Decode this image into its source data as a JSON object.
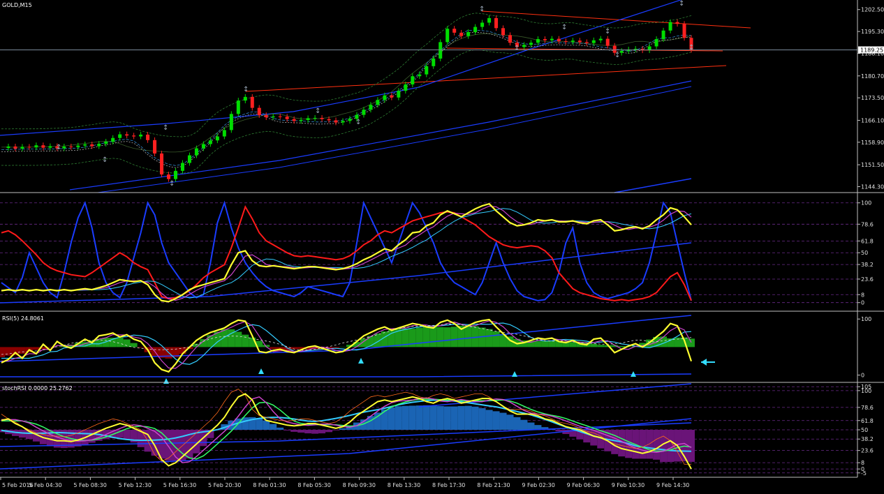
{
  "window": {
    "symbol_label": "GOLD,M15",
    "current_price": "1189.25",
    "bg": "#000000",
    "axis_color": "#c0c0c0",
    "grid_color": "#6a2a8a"
  },
  "panels": {
    "price": {
      "ticks": [
        "1202.50",
        "1195.30",
        "1188.10",
        "1180.70",
        "1173.50",
        "1166.10",
        "1158.90",
        "1151.50",
        "1144.30"
      ],
      "tick_values": [
        1202.5,
        1195.3,
        1188.1,
        1180.7,
        1173.5,
        1166.1,
        1158.9,
        1151.5,
        1144.3
      ],
      "ylim": [
        1143.5,
        1204.5
      ]
    },
    "osc1": {
      "ticks": [
        "100",
        "78.6",
        "61.8",
        "50",
        "38.2",
        "23.6",
        "8",
        "0"
      ],
      "tick_values": [
        100,
        78.6,
        61.8,
        50,
        38.2,
        23.6,
        8,
        0
      ],
      "ylim": [
        -3,
        104
      ]
    },
    "rsi": {
      "label": "RSI(5) 24.8061",
      "ticks": [
        "100",
        "0"
      ],
      "tick_values": [
        100,
        0
      ],
      "ylim": [
        -3,
        104
      ]
    },
    "stoch": {
      "label": "stochRSI 0.0000 25.2762",
      "ticks": [
        "105",
        "100",
        "78.6",
        "61.8",
        "50",
        "38.2",
        "23.6",
        "8",
        "0",
        "-5"
      ],
      "tick_values": [
        105,
        100,
        78.6,
        61.8,
        50,
        38.2,
        23.6,
        8,
        0,
        -5
      ],
      "ylim": [
        -7,
        107
      ]
    }
  },
  "time_axis": {
    "labels": [
      "5 Feb 2016",
      "5 Feb 04:30",
      "5 Feb 08:30",
      "5 Feb 12:30",
      "5 Feb 16:30",
      "5 Feb 20:30",
      "8 Feb 01:30",
      "8 Feb 05:30",
      "8 Feb 09:30",
      "8 Feb 13:30",
      "8 Feb 17:30",
      "8 Feb 21:30",
      "9 Feb 02:30",
      "9 Feb 06:30",
      "9 Feb 10:30",
      "9 Feb 14:30"
    ]
  },
  "chart_data": {
    "type": "line",
    "title": "GOLD,M15",
    "price_series": [
      1157,
      1157.5,
      1156.8,
      1157.4,
      1157.2,
      1157.9,
      1157.1,
      1157.6,
      1156.9,
      1157.5,
      1157.3,
      1157.8,
      1158.2,
      1157.6,
      1158.4,
      1159.1,
      1160.3,
      1161.5,
      1161.1,
      1160.8,
      1161.4,
      1159.6,
      1155.2,
      1148.3,
      1146.8,
      1149.5,
      1152.1,
      1154.6,
      1156.9,
      1158.3,
      1159.5,
      1160.8,
      1162.9,
      1168.2,
      1172.6,
      1173.8,
      1170.2,
      1167.8,
      1167.1,
      1167.4,
      1167.3,
      1166.5,
      1165.9,
      1166.2,
      1166.8,
      1166.9,
      1166.5,
      1166.1,
      1165.4,
      1165.9,
      1166.6,
      1167.9,
      1169.6,
      1171.2,
      1172.8,
      1174.3,
      1173.6,
      1175.8,
      1177.9,
      1180.6,
      1181.2,
      1183.9,
      1186.4,
      1191.8,
      1196.2,
      1194.9,
      1193.8,
      1195.1,
      1196.8,
      1198.2,
      1199.7,
      1196.4,
      1194.1,
      1191.6,
      1190.2,
      1190.9,
      1191.6,
      1192.8,
      1192.4,
      1192.9,
      1192.1,
      1191.9,
      1192.3,
      1191.8,
      1191.5,
      1192.4,
      1192.9,
      1190.6,
      1188.3,
      1188.9,
      1189.4,
      1189.6,
      1189.1,
      1190.4,
      1192.8,
      1195.6,
      1198.4,
      1197.8,
      1193.2,
      1189.25
    ],
    "osc1_series": {
      "yellow": [
        12,
        13,
        12,
        13,
        12,
        13,
        12,
        13,
        12,
        13,
        12,
        13,
        14,
        13,
        15,
        17,
        20,
        23,
        22,
        21,
        22,
        18,
        8,
        2,
        1,
        4,
        8,
        13,
        16,
        18,
        20,
        22,
        24,
        38,
        50,
        52,
        42,
        37,
        36,
        37,
        36,
        35,
        34,
        35,
        36,
        36,
        35,
        34,
        33,
        34,
        36,
        39,
        43,
        46,
        50,
        54,
        52,
        58,
        63,
        70,
        71,
        77,
        80,
        88,
        92,
        89,
        86,
        90,
        94,
        97,
        99,
        92,
        86,
        80,
        77,
        78,
        80,
        83,
        82,
        83,
        81,
        81,
        82,
        80,
        79,
        82,
        83,
        78,
        72,
        73,
        75,
        76,
        74,
        77,
        83,
        88,
        95,
        93,
        86,
        78
      ],
      "red": [
        70,
        72,
        68,
        62,
        55,
        48,
        40,
        35,
        32,
        30,
        28,
        27,
        26,
        30,
        35,
        40,
        45,
        50,
        46,
        40,
        36,
        33,
        20,
        6,
        4,
        5,
        8,
        12,
        18,
        25,
        30,
        34,
        38,
        55,
        75,
        96,
        84,
        70,
        62,
        58,
        54,
        50,
        47,
        46,
        47,
        46,
        45,
        44,
        43,
        44,
        47,
        52,
        58,
        62,
        68,
        72,
        70,
        74,
        78,
        82,
        84,
        86,
        88,
        90,
        91,
        90,
        86,
        82,
        78,
        72,
        66,
        62,
        58,
        56,
        55,
        56,
        57,
        56,
        52,
        45,
        30,
        22,
        14,
        10,
        8,
        6,
        4,
        3,
        2,
        3,
        2,
        3,
        4,
        6,
        10,
        18,
        26,
        30,
        18,
        2
      ],
      "blue": [
        20,
        15,
        10,
        25,
        50,
        35,
        20,
        10,
        5,
        30,
        60,
        85,
        100,
        75,
        40,
        20,
        10,
        5,
        20,
        45,
        70,
        100,
        88,
        60,
        40,
        30,
        20,
        10,
        5,
        8,
        40,
        80,
        100,
        75,
        55,
        40,
        30,
        22,
        16,
        12,
        10,
        8,
        6,
        10,
        16,
        14,
        12,
        10,
        8,
        6,
        20,
        60,
        100,
        85,
        70,
        55,
        40,
        60,
        80,
        100,
        90,
        75,
        60,
        40,
        28,
        20,
        16,
        12,
        8,
        20,
        40,
        60,
        40,
        24,
        12,
        6,
        4,
        2,
        3,
        10,
        30,
        60,
        75,
        40,
        20,
        10,
        6,
        4,
        6,
        8,
        10,
        14,
        20,
        40,
        70,
        100,
        90,
        60,
        30,
        2
      ]
    },
    "rsi_series": [
      22,
      28,
      40,
      30,
      45,
      38,
      55,
      44,
      60,
      52,
      48,
      56,
      64,
      58,
      70,
      72,
      75,
      68,
      72,
      64,
      60,
      45,
      22,
      10,
      6,
      20,
      38,
      50,
      62,
      70,
      76,
      80,
      84,
      92,
      98,
      96,
      70,
      42,
      40,
      44,
      46,
      42,
      40,
      45,
      50,
      52,
      48,
      44,
      40,
      42,
      50,
      60,
      70,
      76,
      82,
      86,
      80,
      84,
      88,
      92,
      90,
      86,
      84,
      94,
      98,
      92,
      82,
      88,
      94,
      97,
      99,
      86,
      74,
      62,
      56,
      58,
      62,
      66,
      64,
      66,
      60,
      58,
      62,
      56,
      54,
      64,
      66,
      54,
      40,
      46,
      52,
      56,
      50,
      58,
      68,
      78,
      92,
      88,
      62,
      24.8
    ],
    "stoch_series": [
      62,
      64,
      58,
      54,
      48,
      44,
      40,
      38,
      36,
      36,
      35,
      37,
      40,
      44,
      48,
      52,
      55,
      58,
      56,
      52,
      48,
      44,
      30,
      12,
      4,
      8,
      16,
      24,
      32,
      40,
      48,
      56,
      66,
      80,
      92,
      96,
      88,
      70,
      62,
      60,
      58,
      56,
      55,
      56,
      58,
      58,
      56,
      54,
      52,
      54,
      60,
      68,
      74,
      80,
      86,
      88,
      86,
      88,
      90,
      92,
      90,
      86,
      84,
      88,
      90,
      88,
      84,
      86,
      88,
      90,
      90,
      86,
      80,
      74,
      70,
      70,
      70,
      68,
      64,
      62,
      58,
      54,
      52,
      50,
      46,
      42,
      40,
      36,
      30,
      26,
      24,
      22,
      20,
      22,
      26,
      32,
      36,
      30,
      16,
      0
    ]
  },
  "colors": {
    "bull_candle": "#00dd00",
    "bear_candle": "#ff2020",
    "channel_red": "#ff3010",
    "channel_blue": "#1a3cff",
    "yellow_line": "#ffff30",
    "cyan_line": "#33ccff",
    "hist_green": "#1a9a1a",
    "hist_darkred": "#8a0000",
    "hist_blue": "#1a64b4",
    "hist_purple": "#6a1478",
    "arrow_gray": "#9aa8b8",
    "cyan_arrow": "#33ddff"
  }
}
